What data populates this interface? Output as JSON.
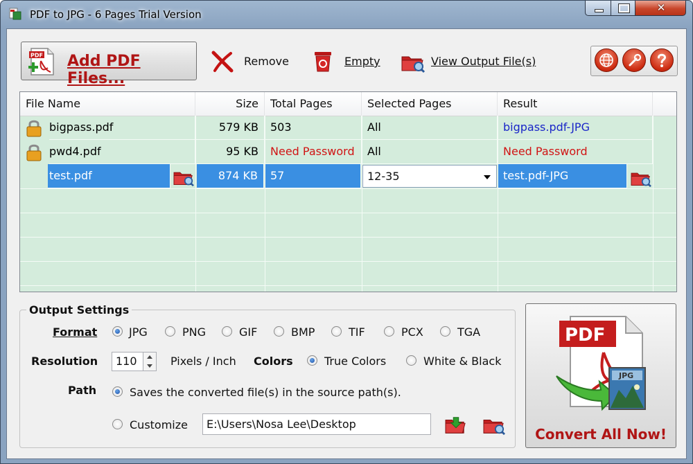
{
  "window": {
    "title": "PDF to JPG - 6 Pages Trial Version",
    "close_glyph": "✕"
  },
  "toolbar": {
    "add_label": "Add PDF Files...",
    "remove_label": "Remove",
    "empty_label": "Empty",
    "view_output_label": "View Output File(s)",
    "icons": [
      "globe-icon",
      "wrench-icon",
      "help-icon"
    ]
  },
  "file_table": {
    "columns": [
      "File Name",
      "Size",
      "Total Pages",
      "Selected Pages",
      "Result"
    ],
    "rows": [
      {
        "name": "bigpass.pdf",
        "size": "579 KB",
        "total_pages": "503",
        "selected_pages": "All",
        "result": "bigpass.pdf-JPG"
      },
      {
        "name": "pwd4.pdf",
        "size": "95 KB",
        "total_pages": "Need Password",
        "selected_pages": "All",
        "result": "Need Password"
      },
      {
        "name": "test.pdf",
        "size": "874 KB",
        "total_pages": "57",
        "selected_pages": "12-35",
        "result": "test.pdf-JPG"
      }
    ]
  },
  "output_settings": {
    "title": "Output Settings",
    "format_label": "Format",
    "formats": [
      "JPG",
      "PNG",
      "GIF",
      "BMP",
      "TIF",
      "PCX",
      "TGA"
    ],
    "selected_format": "JPG",
    "resolution_label": "Resolution",
    "resolution_value": "110",
    "resolution_unit": "Pixels / Inch",
    "colors_label": "Colors",
    "color_options": [
      "True Colors",
      "White & Black"
    ],
    "selected_color": "True Colors",
    "path_label": "Path",
    "path_source_option": "Saves the converted file(s) in the source path(s).",
    "path_customize_option": "Customize",
    "custom_path_value": "E:\\Users\\Nosa Lee\\Desktop"
  },
  "convert": {
    "label": "Convert All Now!",
    "pdf_text": "PDF",
    "jpg_text": "JPG"
  },
  "colors": {
    "accent_red": "#b01515",
    "grid_bg": "#d4ecdc",
    "selection_blue": "#3a8fe2",
    "result_blue": "#1a26c8"
  }
}
